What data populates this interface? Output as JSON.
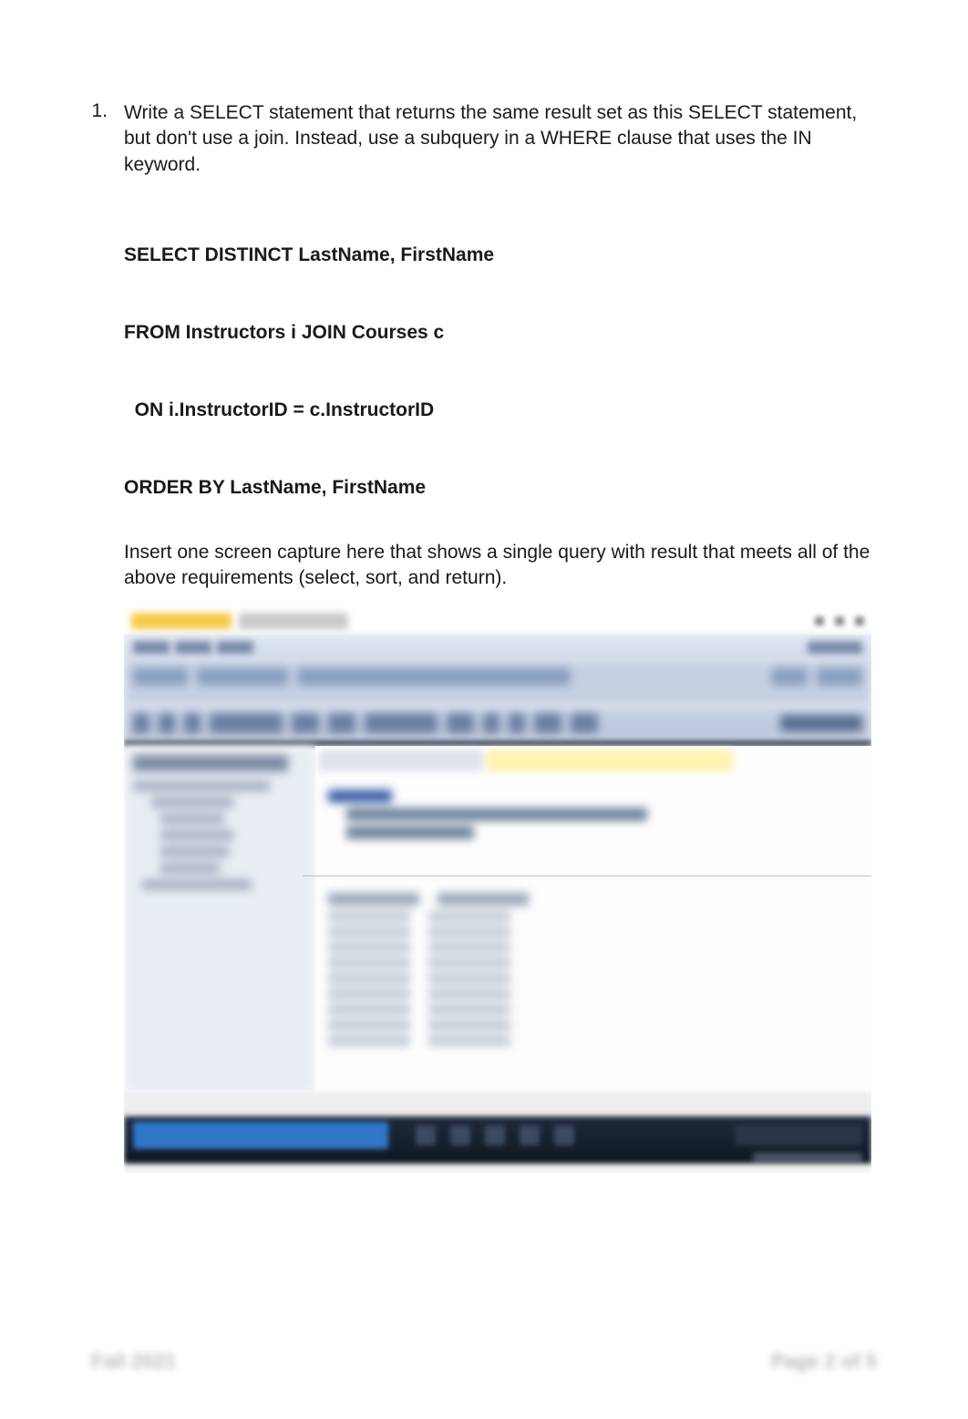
{
  "question": {
    "number": "1.",
    "text": "Write a SELECT statement that returns the same result set as this SELECT statement, but don't use a join. Instead, use a subquery in a WHERE clause that uses the IN keyword."
  },
  "code": {
    "line1": "SELECT DISTINCT LastName, FirstName",
    "line2": "FROM Instructors i JOIN Courses c",
    "line3": "  ON i.InstructorID = c.InstructorID",
    "line4": "ORDER BY LastName, FirstName"
  },
  "instruction": "Insert one screen capture here that shows a single query with result that meets all of the above requirements (select, sort, and return).",
  "footer": {
    "left": "Fall 2021",
    "right": "Page 2 of 5"
  }
}
